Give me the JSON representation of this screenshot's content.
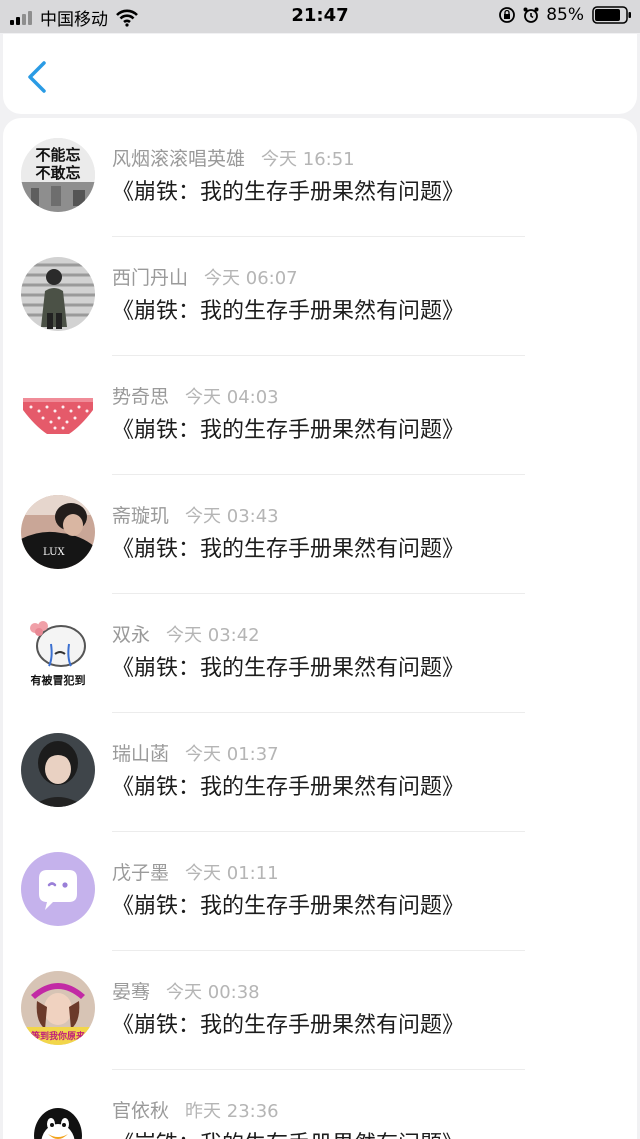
{
  "status_bar": {
    "carrier": "中国移动",
    "time": "21:47",
    "battery": "85%"
  },
  "header": {
    "back_icon": "chevron-left-icon",
    "accent_color": "#2a9be4"
  },
  "items": [
    {
      "name": "风烟滚滚唱英雄",
      "time": "今天 16:51",
      "title": "《崩铁：我的生存手册果然有问题》",
      "avatar_text": [
        "不能忘",
        "不敢忘"
      ]
    },
    {
      "name": "西门丹山",
      "time": "今天 06:07",
      "title": "《崩铁：我的生存手册果然有问题》"
    },
    {
      "name": "势奇思",
      "time": "今天 04:03",
      "title": "《崩铁：我的生存手册果然有问题》"
    },
    {
      "name": "斋璇玑",
      "time": "今天 03:43",
      "title": "《崩铁：我的生存手册果然有问题》",
      "avatar_text": [
        "LUX"
      ]
    },
    {
      "name": "双永",
      "time": "今天 03:42",
      "title": "《崩铁：我的生存手册果然有问题》",
      "avatar_text": [
        "有被冒犯到"
      ]
    },
    {
      "name": "瑞山菡",
      "time": "今天 01:37",
      "title": "《崩铁：我的生存手册果然有问题》"
    },
    {
      "name": "戊子墨",
      "time": "今天 01:11",
      "title": "《崩铁：我的生存手册果然有问题》"
    },
    {
      "name": "晏骞",
      "time": "今天 00:38",
      "title": "《崩铁：我的生存手册果然有问题》",
      "avatar_text": [
        "等到我你原来"
      ]
    },
    {
      "name": "官依秋",
      "time": "昨天 23:36",
      "title": "《崩铁：我的生存手册果然有问题》"
    }
  ]
}
